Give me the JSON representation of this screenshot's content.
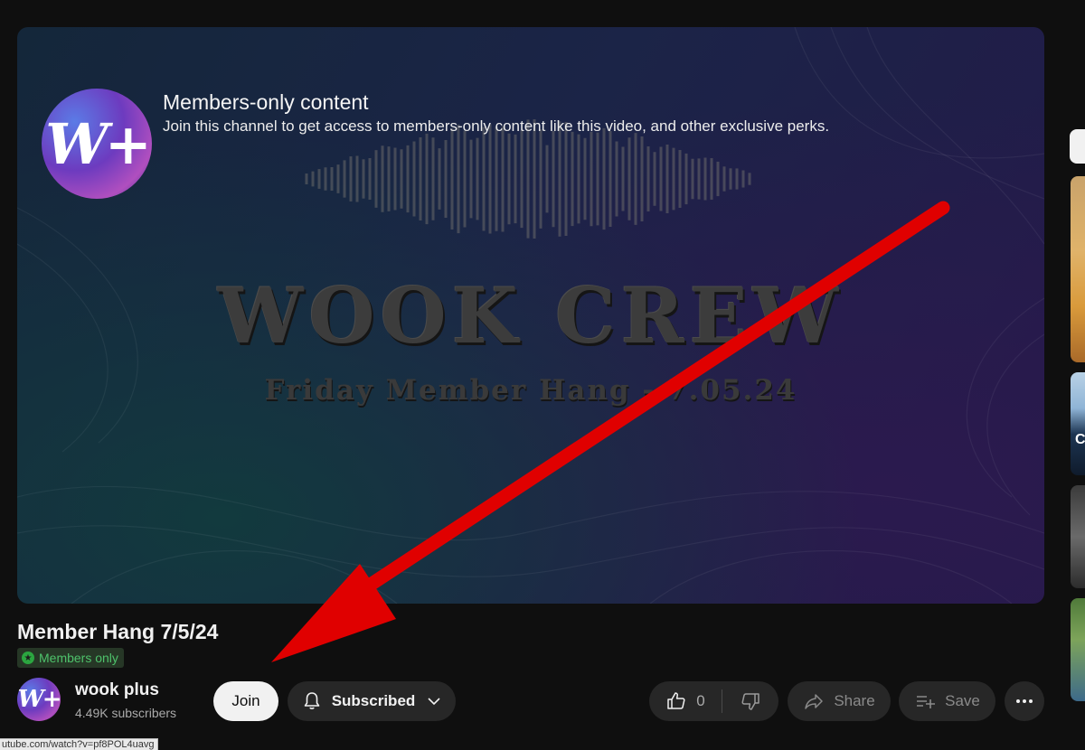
{
  "player": {
    "overlay_title": "Members-only content",
    "overlay_description": "Join this channel to get access to members-only content like this video, and other exclusive perks.",
    "badge_logo": "W+",
    "thumbnail_title": "WOOK CREW",
    "thumbnail_subtitle": "Friday Member Hang - 7.05.24"
  },
  "video": {
    "title": "Member Hang 7/5/24",
    "badge": "Members only"
  },
  "owner": {
    "avatar_logo": "W+",
    "channel_name": "wook plus",
    "subscribers": "4.49K subscribers"
  },
  "actions": {
    "join_label": "Join",
    "subscribed_label": "Subscribed",
    "like_count": "0",
    "share_label": "Share",
    "save_label": "Save"
  },
  "status_bar": {
    "url": "utube.com/watch?v=pf8POL4uavg"
  },
  "recommendations": {
    "thumb2_text": "C"
  },
  "icons": {
    "badge": "members-star-icon",
    "bell": "bell-icon",
    "chevron": "chevron-down-icon",
    "like": "thumbs-up-icon",
    "dislike": "thumbs-down-icon",
    "share": "share-arrow-icon",
    "save": "playlist-add-icon",
    "more": "more-horizontal-icon"
  },
  "colors": {
    "background": "#0f0f0f",
    "pill": "#272727",
    "members_green": "#2ba640",
    "arrow_red": "#e00000"
  }
}
